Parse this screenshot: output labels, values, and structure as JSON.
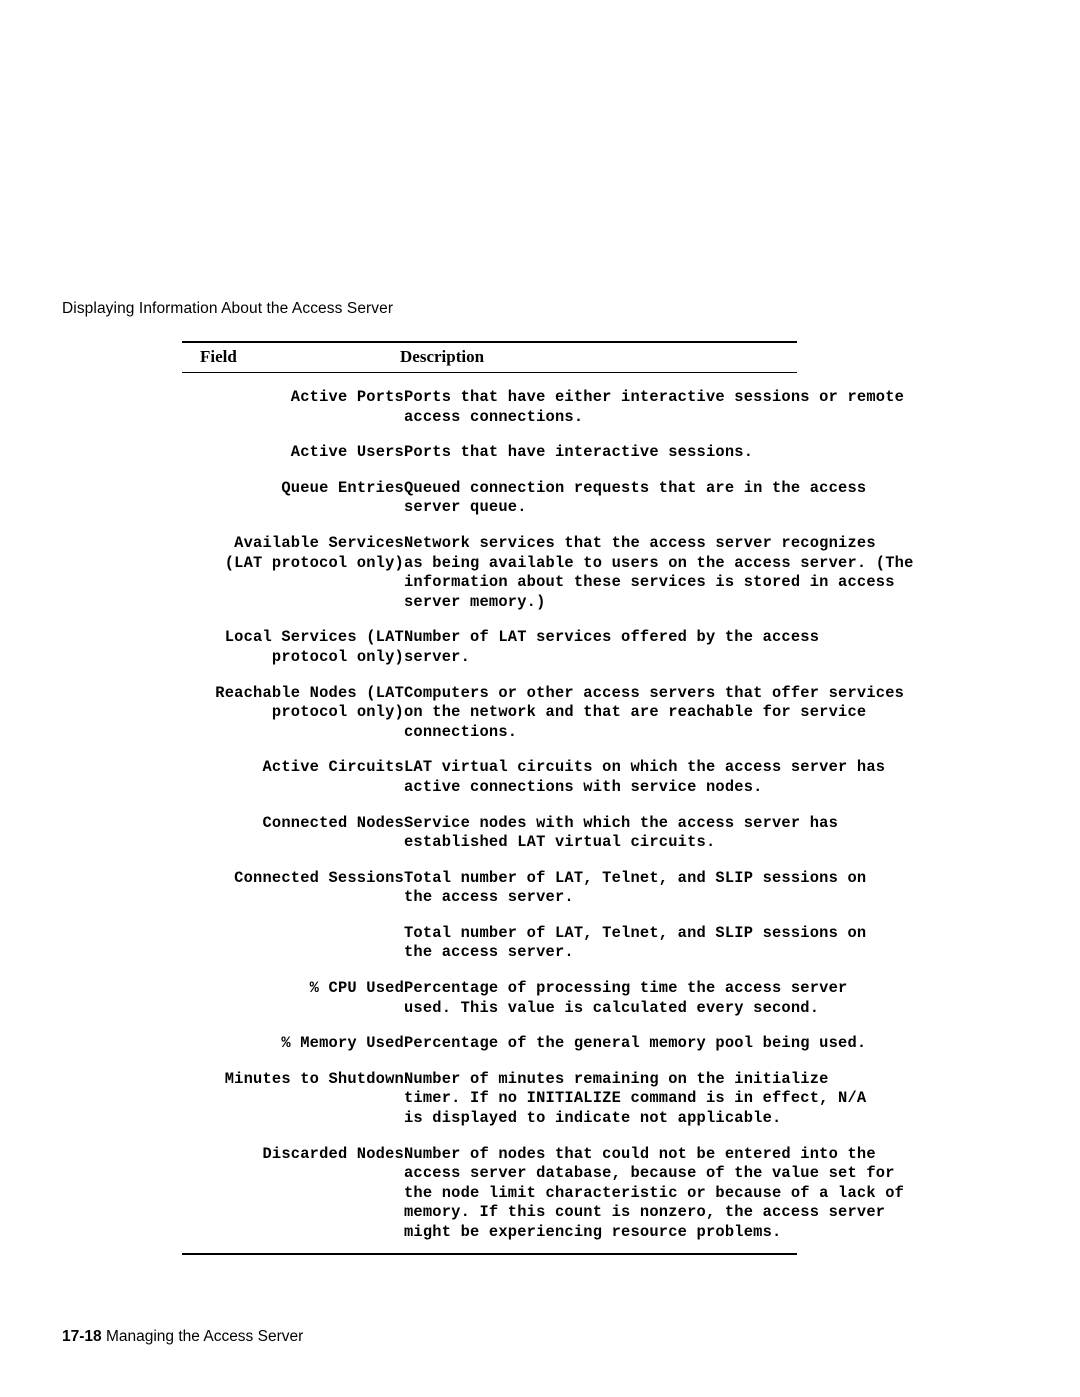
{
  "page": {
    "running_head": "Displaying Information About the Access Server",
    "footer_page_number": "17-18",
    "footer_text": "Managing the Access Server"
  },
  "table": {
    "headers": {
      "field": "Field",
      "description": "Description"
    },
    "rows": [
      {
        "field": "Active Ports",
        "field_align": "right",
        "description": "Ports that have either interactive sessions or remote\naccess connections."
      },
      {
        "field": "Active Users",
        "field_align": "right",
        "description": "Ports that have interactive sessions."
      },
      {
        "field": "Queue Entries",
        "field_align": "right",
        "description": "Queued connection requests that are in the access\nserver queue."
      },
      {
        "field": "Available Services\n(LAT protocol only)",
        "field_align": "right",
        "description": "Network services that the access server recognizes\nas being available to users on the access server. (The\ninformation about these services is stored in access\nserver memory.)"
      },
      {
        "field": "Local Services (LAT\nprotocol only)",
        "field_align": "right",
        "description": "Number of LAT services offered by the access\nserver."
      },
      {
        "field": "Reachable Nodes (LAT\nprotocol only)",
        "field_align": "right",
        "description": "Computers or other access servers that offer services\non the network and that are reachable for service\nconnections."
      },
      {
        "field": "Active Circuits",
        "field_align": "right",
        "description": "LAT virtual circuits on which the access server has\nactive connections with service nodes."
      },
      {
        "field": "Connected Nodes",
        "field_align": "right",
        "description": "Service nodes with which the access server has\nestablished LAT virtual circuits."
      },
      {
        "field": "Connected Sessions",
        "field_align": "right",
        "description": "Total number of LAT, Telnet, and SLIP sessions on\nthe access server."
      },
      {
        "field": "",
        "field_align": "right",
        "description": "Total number of LAT, Telnet, and SLIP sessions on\nthe access server."
      },
      {
        "field": "% CPU Used",
        "field_align": "right",
        "description": "Percentage of processing time the access server\nused. This value is calculated every second."
      },
      {
        "field": "% Memory Used",
        "field_align": "right",
        "description": "Percentage of the general memory pool being used."
      },
      {
        "field": "Minutes to Shutdown",
        "field_align": "right",
        "description": "Number of minutes remaining on the initialize\ntimer. If no INITIALIZE command is in effect, N/A\nis displayed to indicate not applicable."
      },
      {
        "field": "Discarded Nodes",
        "field_align": "right",
        "description": "Number of nodes that could not be entered into the\naccess server database, because of the value set for\nthe node limit characteristic or because of a lack of\nmemory. If this count is nonzero, the access server\nmight be experiencing resource problems."
      }
    ]
  }
}
